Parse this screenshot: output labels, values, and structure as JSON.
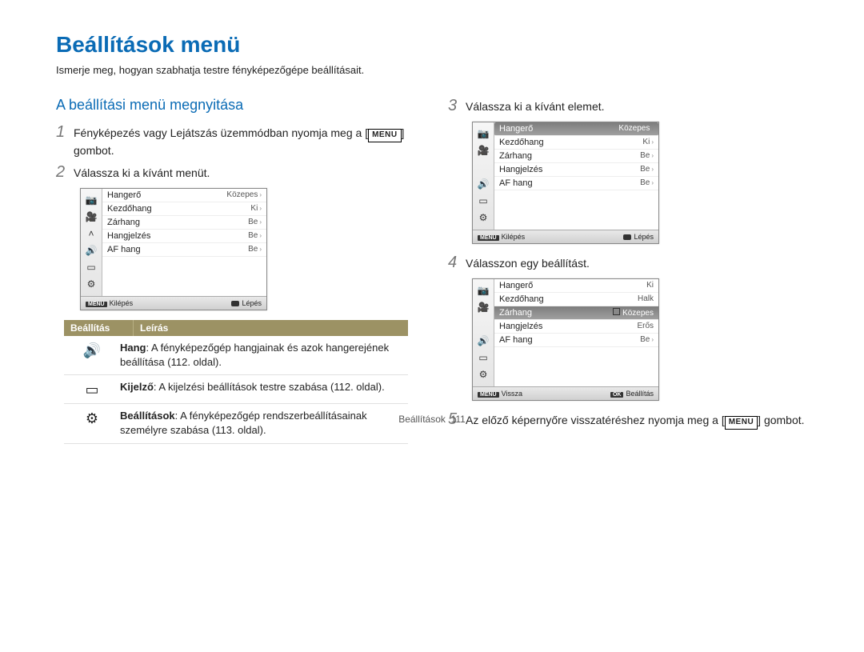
{
  "title": "Beállítások menü",
  "subtitle": "Ismerje meg, hogyan szabhatja testre fényképezőgépe beállításait.",
  "section_open": "A beállítási menü megnyitása",
  "steps": {
    "s1a": "Fényképezés vagy Lejátszás üzemmódban nyomja meg a",
    "s1b": "[",
    "s1_menu": "MENU",
    "s1c": "] gombot.",
    "s2": "Válassza ki a kívánt menüt.",
    "s3": "Válassza ki a kívánt elemet.",
    "s4": "Válasszon egy beállítást.",
    "s5a": "Az előző képernyőre visszatéréshez nyomja meg a [",
    "s5_menu": "MENU",
    "s5b": "] gombot."
  },
  "cam_a": {
    "rows": [
      {
        "label": "Hangerő",
        "val": "Közepes",
        "arrow": true
      },
      {
        "label": "Kezdőhang",
        "val": "Ki",
        "arrow": true
      },
      {
        "label": "Zárhang",
        "val": "Be",
        "arrow": true
      },
      {
        "label": "Hangjelzés",
        "val": "Be",
        "arrow": true
      },
      {
        "label": "AF hang",
        "val": "Be",
        "arrow": true
      }
    ],
    "foot_left": "Kilépés",
    "foot_right": "Lépés"
  },
  "cam_b": {
    "rows": [
      {
        "label": "Hangerő",
        "val": "Közepes",
        "sel": true,
        "arrow": true
      },
      {
        "label": "Kezdőhang",
        "val": "Ki",
        "arrow": true
      },
      {
        "label": "Zárhang",
        "val": "Be",
        "arrow": true
      },
      {
        "label": "Hangjelzés",
        "val": "Be",
        "arrow": true
      },
      {
        "label": "AF hang",
        "val": "Be",
        "arrow": true
      }
    ],
    "foot_left": "Kilépés",
    "foot_right": "Lépés"
  },
  "cam_c": {
    "rows": [
      {
        "label": "Hangerő",
        "val": "Ki"
      },
      {
        "label": "Kezdőhang",
        "val": "Halk"
      },
      {
        "label": "Zárhang",
        "val": "Közepes",
        "sel_val": true
      },
      {
        "label": "Hangjelzés",
        "val": "Erős"
      },
      {
        "label": "AF hang",
        "val": "Be",
        "arrow": true
      }
    ],
    "foot_left": "Vissza",
    "foot_right": "Beállítás"
  },
  "table": {
    "h1": "Beállítás",
    "h2": "Leírás",
    "rows": [
      {
        "icon": "🔊",
        "bold": "Hang",
        "text": ": A fényképezőgép hangjainak és azok hangerejének beállítása (112. oldal)."
      },
      {
        "icon": "▭",
        "bold": "Kijelző",
        "text": ": A kijelzési beállítások testre szabása (112. oldal)."
      },
      {
        "icon": "⚙",
        "bold": "Beállítások",
        "text": ": A fényképezőgép rendszerbeállításainak személyre szabása (113. oldal)."
      }
    ]
  },
  "footer": {
    "label": "Beállítások",
    "page": "111"
  }
}
